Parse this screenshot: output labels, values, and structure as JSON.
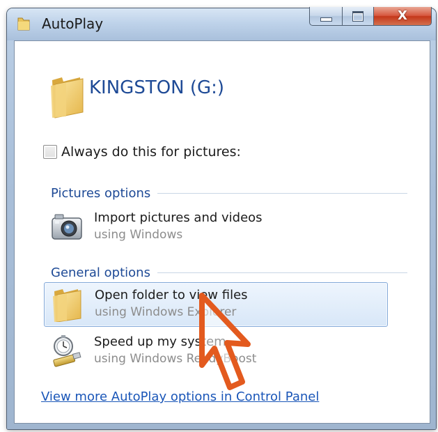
{
  "window": {
    "title": "AutoPlay",
    "close_glyph": "X"
  },
  "drive": {
    "name": "KINGSTON (G:)",
    "icon": "folder-icon"
  },
  "always_checkbox": {
    "label": "Always do this for pictures:",
    "checked": false
  },
  "groups": {
    "pictures": {
      "label": "Pictures options",
      "options": [
        {
          "title": "Import pictures and videos",
          "subtitle": "using Windows",
          "icon": "camera-icon"
        }
      ]
    },
    "general": {
      "label": "General options",
      "options": [
        {
          "title": "Open folder to view files",
          "subtitle": "using Windows Explorer",
          "icon": "folder-icon",
          "selected": true
        },
        {
          "title": "Speed up my system",
          "subtitle": "using Windows ReadyBoost",
          "icon": "readyboost-icon",
          "selected": false
        }
      ]
    }
  },
  "control_panel_link": "View more AutoPlay options in Control Panel",
  "colors": {
    "heading_blue": "#1e4a96",
    "link_blue": "#1a56b8",
    "cursor_orange": "#e35a1e",
    "close_red": "#c4371a"
  }
}
